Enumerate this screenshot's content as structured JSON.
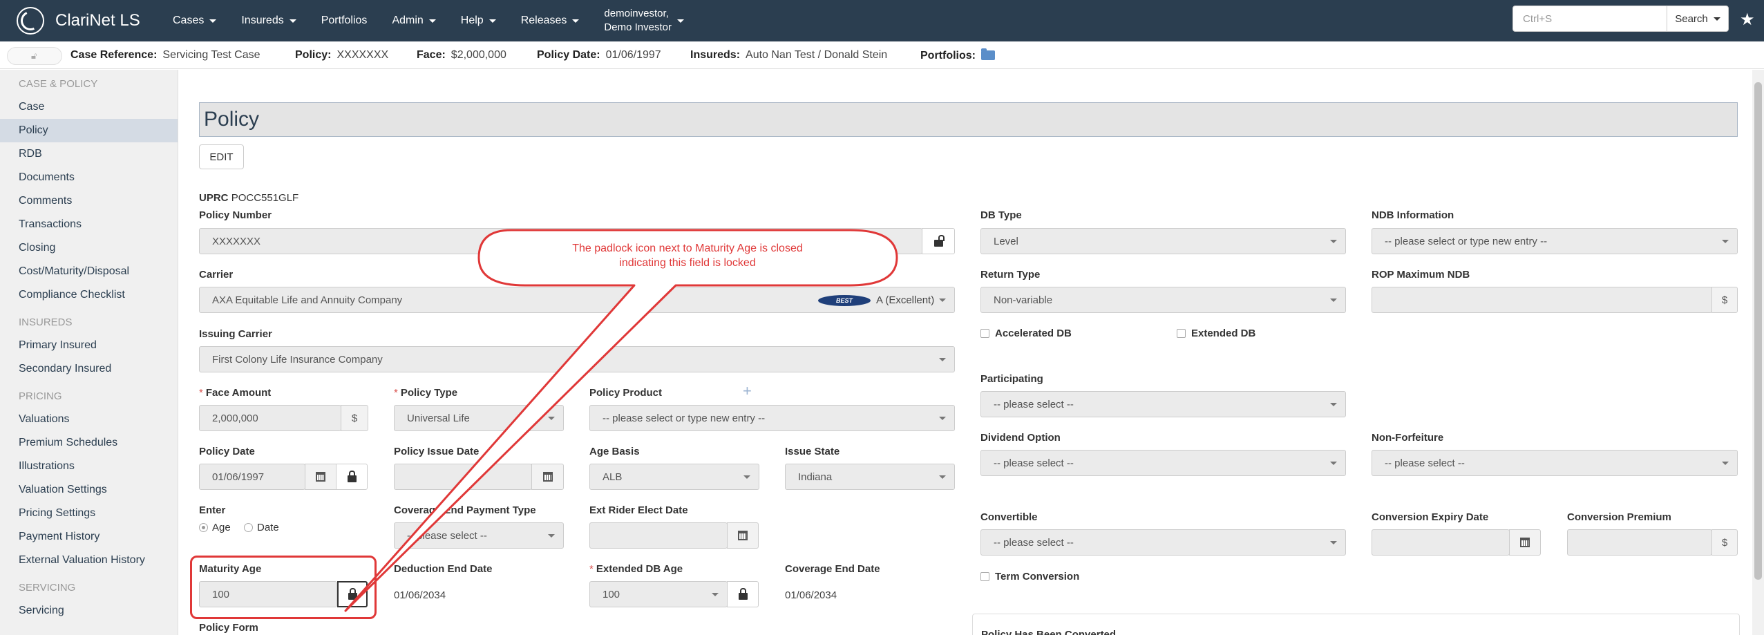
{
  "app": {
    "name": "ClariNet LS"
  },
  "nav": {
    "items": [
      "Cases",
      "Insureds",
      "Portfolios",
      "Admin",
      "Help",
      "Releases"
    ],
    "user_line1": "demoinvestor,",
    "user_line2": "Demo Investor",
    "search_placeholder": "Ctrl+S",
    "search_button": "Search"
  },
  "casebar": {
    "case_reference_label": "Case Reference:",
    "case_reference_value": "Servicing Test Case",
    "policy_label": "Policy:",
    "policy_value": "XXXXXXX",
    "face_label": "Face:",
    "face_value": "$2,000,000",
    "policy_date_label": "Policy Date:",
    "policy_date_value": "01/06/1997",
    "insureds_label": "Insureds:",
    "insureds_value": "Auto Nan Test / Donald Stein",
    "portfolios_label": "Portfolios:"
  },
  "sidebar": {
    "sections": [
      {
        "title": "CASE & POLICY",
        "items": [
          "Case",
          "Policy",
          "RDB",
          "Documents",
          "Comments",
          "Transactions",
          "Closing",
          "Cost/Maturity/Disposal",
          "Compliance Checklist"
        ]
      },
      {
        "title": "INSUREDS",
        "items": [
          "Primary Insured",
          "Secondary Insured"
        ]
      },
      {
        "title": "PRICING",
        "items": [
          "Valuations",
          "Premium Schedules",
          "Illustrations",
          "Valuation Settings",
          "Pricing Settings",
          "Payment History",
          "External Valuation History"
        ]
      },
      {
        "title": "SERVICING",
        "items": [
          "Servicing"
        ]
      }
    ],
    "active": "Policy"
  },
  "main": {
    "title": "Policy",
    "edit_button": "EDIT",
    "uprc_label": "UPRC",
    "uprc_value": "POCC551GLF",
    "policy_number_label": "Policy Number",
    "policy_number_value": "XXXXXXX",
    "carrier_label": "Carrier",
    "carrier_value": "AXA Equitable Life and Annuity Company",
    "carrier_rating_logo": "BEST",
    "carrier_rating": "A (Excellent)",
    "issuing_carrier_label": "Issuing Carrier",
    "issuing_carrier_value": "First Colony Life Insurance Company",
    "face_amount_label": "Face Amount",
    "face_amount_value": "2,000,000",
    "currency_symbol": "$",
    "policy_type_label": "Policy Type",
    "policy_type_value": "Universal Life",
    "policy_product_label": "Policy Product",
    "policy_product_placeholder": "-- please select or type new entry --",
    "policy_date_label": "Policy Date",
    "policy_date_value": "01/06/1997",
    "policy_issue_date_label": "Policy Issue Date",
    "age_basis_label": "Age Basis",
    "age_basis_value": "ALB",
    "issue_state_label": "Issue State",
    "issue_state_value": "Indiana",
    "enter_label": "Enter",
    "enter_option_age": "Age",
    "enter_option_date": "Date",
    "coverage_end_payment_type_label": "Coverage End Payment Type",
    "coverage_end_payment_type_placeholder": "-- please select --",
    "ext_rider_elect_date_label": "Ext Rider Elect Date",
    "maturity_age_label": "Maturity Age",
    "maturity_age_value": "100",
    "deduction_end_date_label": "Deduction End Date",
    "deduction_end_date_value": "01/06/2034",
    "extended_db_age_label": "Extended DB Age",
    "extended_db_age_value": "100",
    "coverage_end_date_label": "Coverage End Date",
    "coverage_end_date_value": "01/06/2034",
    "policy_form_label": "Policy Form",
    "db_type_label": "DB Type",
    "db_type_value": "Level",
    "ndb_information_label": "NDB Information",
    "ndb_information_placeholder": "-- please select or type new entry --",
    "return_type_label": "Return Type",
    "return_type_value": "Non-variable",
    "rop_maximum_ndb_label": "ROP Maximum NDB",
    "accelerated_db_label": "Accelerated DB",
    "extended_db_label": "Extended DB",
    "participating_label": "Participating",
    "participating_placeholder": "-- please select --",
    "dividend_option_label": "Dividend Option",
    "dividend_option_placeholder": "-- please select --",
    "non_forfeiture_label": "Non-Forfeiture",
    "non_forfeiture_placeholder": "-- please select --",
    "convertible_label": "Convertible",
    "convertible_placeholder": "-- please select --",
    "conversion_expiry_date_label": "Conversion Expiry Date",
    "conversion_premium_label": "Conversion Premium",
    "term_conversion_label": "Term Conversion",
    "policy_has_been_converted_label": "Policy Has Been Converted"
  },
  "annotation": {
    "line1": "The padlock icon next to Maturity Age is closed",
    "line2": "indicating this field is locked"
  },
  "colors": {
    "navbar": "#2b3e50",
    "annotation": "#e03838",
    "active_sidebar": "#d4dbe4"
  }
}
